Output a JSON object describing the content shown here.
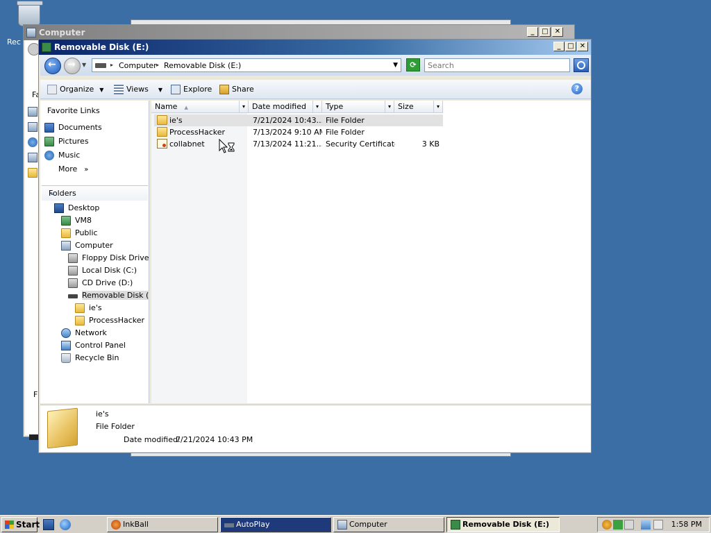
{
  "desktop": {
    "recycle_bin_label": "Rec"
  },
  "back_window": {
    "title": "Computer",
    "side_labels": [
      "Fa",
      "F"
    ]
  },
  "window": {
    "title": "Removable Disk (E:)",
    "controls": {
      "minimize": "_",
      "maximize": "□",
      "close": "✕"
    }
  },
  "address": {
    "crumbs": [
      "Computer",
      "Removable Disk (E:)"
    ],
    "search_placeholder": "Search"
  },
  "toolbar": {
    "organize": "Organize",
    "views": "Views",
    "explore": "Explore",
    "share": "Share",
    "help": "?"
  },
  "nav": {
    "favorites_title": "Favorite Links",
    "favorites": [
      {
        "label": "Documents",
        "icon": "documents-icon"
      },
      {
        "label": "Pictures",
        "icon": "pictures-icon"
      },
      {
        "label": "Music",
        "icon": "music-icon"
      },
      {
        "label": "More",
        "icon": ""
      }
    ],
    "more_chevron": "»",
    "folders_title": "Folders",
    "folders_chevron": "⌄",
    "tree": [
      {
        "label": "Desktop",
        "level": 0,
        "icon": "desktop-icon"
      },
      {
        "label": "VM8",
        "level": 1,
        "icon": "user-icon"
      },
      {
        "label": "Public",
        "level": 1,
        "icon": "folder-icon"
      },
      {
        "label": "Computer",
        "level": 1,
        "icon": "computer-icon"
      },
      {
        "label": "Floppy Disk Drive (A:)",
        "level": 2,
        "icon": "floppy-icon"
      },
      {
        "label": "Local Disk (C:)",
        "level": 2,
        "icon": "hard-disk-icon"
      },
      {
        "label": "CD Drive (D:)",
        "level": 2,
        "icon": "cd-drive-icon"
      },
      {
        "label": "Removable Disk (E:)",
        "level": 2,
        "icon": "usb-drive-icon",
        "selected": true
      },
      {
        "label": "ie's",
        "level": 3,
        "icon": "folder-icon"
      },
      {
        "label": "ProcessHacker",
        "level": 3,
        "icon": "folder-icon"
      },
      {
        "label": "Network",
        "level": 1,
        "icon": "network-icon"
      },
      {
        "label": "Control Panel",
        "level": 1,
        "icon": "control-panel-icon"
      },
      {
        "label": "Recycle Bin",
        "level": 1,
        "icon": "recycle-bin-icon"
      }
    ]
  },
  "files": {
    "columns": {
      "name": "Name",
      "date": "Date modified",
      "type": "Type",
      "size": "Size"
    },
    "sort_indicator": "▲",
    "dropdown_glyph": "▾",
    "rows": [
      {
        "name": "ie's",
        "date": "7/21/2024 10:43...",
        "type": "File Folder",
        "size": "",
        "icon": "folder-icon",
        "selected": true
      },
      {
        "name": "ProcessHacker",
        "date": "7/13/2024 9:10 AM",
        "type": "File Folder",
        "size": "",
        "icon": "folder-icon"
      },
      {
        "name": "collabnet",
        "date": "7/13/2024 11:21...",
        "type": "Security Certificate",
        "size": "3 KB",
        "icon": "certificate-icon"
      }
    ]
  },
  "details": {
    "name": "ie's",
    "type": "File Folder",
    "date_label": "Date modified:",
    "date_value": "7/21/2024 10:43 PM"
  },
  "taskbar": {
    "start": "Start",
    "buttons": [
      {
        "label": "InkBall",
        "icon": "inkball-icon"
      },
      {
        "label": "AutoPlay",
        "icon": "autoplay-icon"
      },
      {
        "label": "Computer",
        "icon": "computer-icon"
      },
      {
        "label": "Removable Disk (E:)",
        "icon": "usb-drive-icon"
      }
    ],
    "clock": "1:58 PM"
  }
}
